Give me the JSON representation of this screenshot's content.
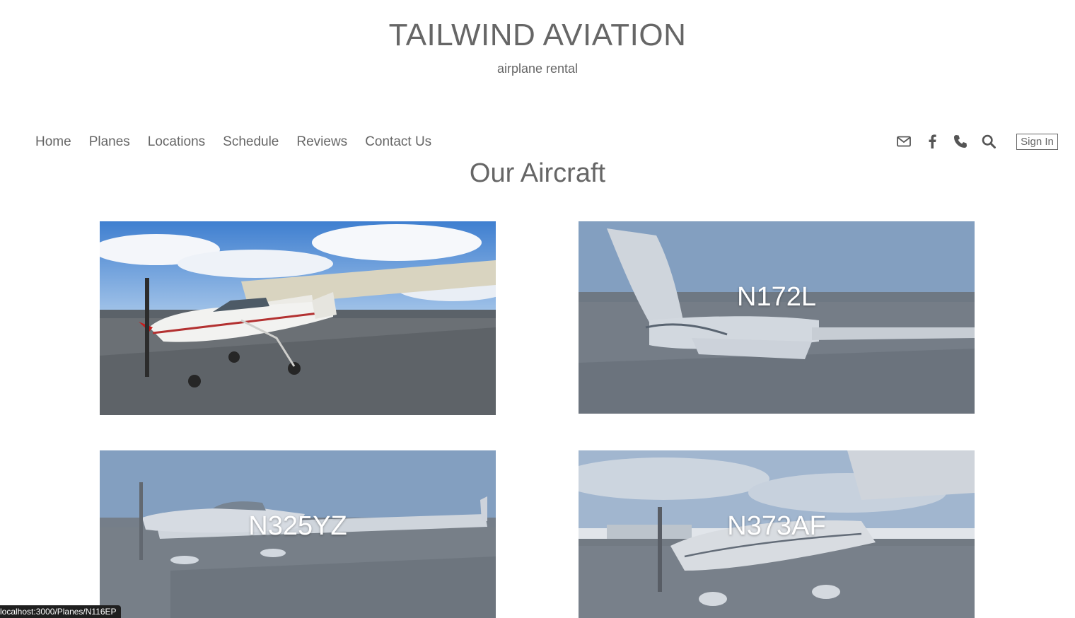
{
  "header": {
    "title": "TAILWIND AVIATION",
    "tagline": "airplane rental"
  },
  "nav": {
    "links": [
      "Home",
      "Planes",
      "Locations",
      "Schedule",
      "Reviews",
      "Contact Us"
    ],
    "icons": [
      "mail-icon",
      "facebook-icon",
      "phone-icon",
      "search-icon"
    ],
    "sign_in_label": "Sign In"
  },
  "main": {
    "section_title": "Our Aircraft",
    "aircraft": [
      {
        "tail_number": "",
        "hover": true
      },
      {
        "tail_number": "N172L",
        "hover": false
      },
      {
        "tail_number": "N325YZ",
        "hover": false
      },
      {
        "tail_number": "N373AF",
        "hover": false
      }
    ]
  },
  "status_bar": {
    "url": "localhost:3000/Planes/N116EP"
  },
  "colors": {
    "text": "#666666",
    "background": "#ffffff",
    "overlay": "#aab4c3"
  }
}
